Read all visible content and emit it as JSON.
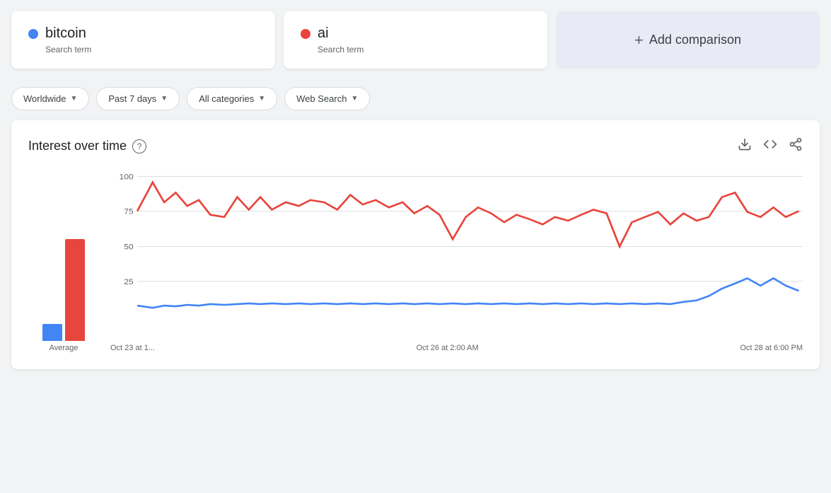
{
  "terms": [
    {
      "id": "bitcoin",
      "label": "bitcoin",
      "subtitle": "Search term",
      "dot_color": "#4285F4"
    },
    {
      "id": "ai",
      "label": "ai",
      "subtitle": "Search term",
      "dot_color": "#E8453C"
    }
  ],
  "add_comparison_label": "Add comparison",
  "filters": [
    {
      "id": "region",
      "label": "Worldwide"
    },
    {
      "id": "time",
      "label": "Past 7 days"
    },
    {
      "id": "category",
      "label": "All categories"
    },
    {
      "id": "search_type",
      "label": "Web Search"
    }
  ],
  "chart": {
    "title": "Interest over time",
    "help_text": "?",
    "y_labels": [
      "100",
      "75",
      "50",
      "25"
    ],
    "x_labels": [
      "Oct 23 at 1...",
      "Oct 26 at 2:00 AM",
      "Oct 28 at 6:00 PM"
    ],
    "avg_label": "Average",
    "bars": [
      {
        "color": "#4285F4",
        "height_pct": 12
      },
      {
        "color": "#E8453C",
        "height_pct": 72
      }
    ],
    "icons": {
      "download": "⬇",
      "embed": "<>",
      "share": "↗"
    }
  }
}
